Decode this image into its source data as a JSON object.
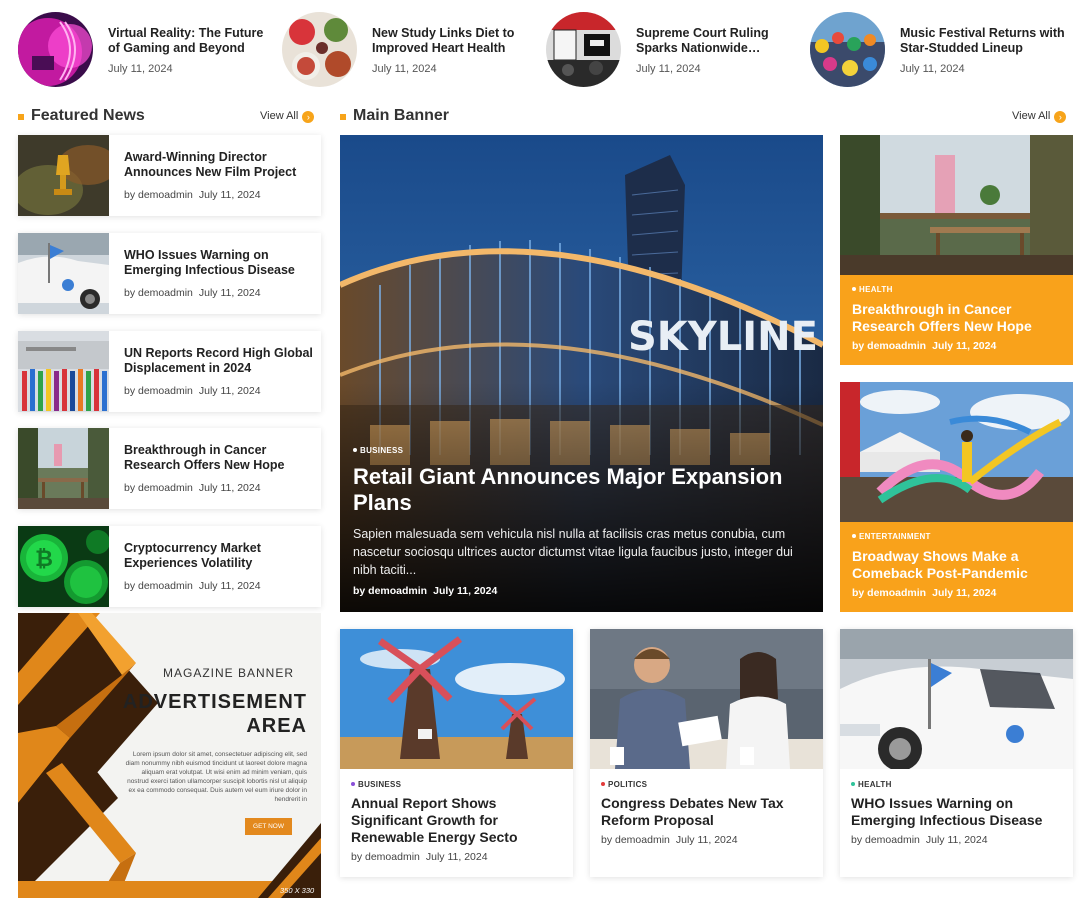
{
  "ticker": [
    {
      "title": "Virtual Reality: The Future of Gaming and Beyond",
      "date": "July 11, 2024",
      "image": "vr-headset-neon"
    },
    {
      "title": "New Study Links Diet to Improved Heart Health",
      "date": "July 11, 2024",
      "image": "healthy-food-table"
    },
    {
      "title": "Supreme Court Ruling Sparks Nationwide…",
      "date": "July 11, 2024",
      "image": "protest-signs"
    },
    {
      "title": "Music Festival Returns with Star-Studded Lineup",
      "date": "July 11, 2024",
      "image": "festival-crowd"
    }
  ],
  "featured": {
    "heading": "Featured News",
    "view_all": "View All",
    "items": [
      {
        "title": "Award-Winning Director Announces New Film Project",
        "author": "by demoadmin",
        "date": "July 11, 2024",
        "image": "golden-trophy-smoke"
      },
      {
        "title": "WHO Issues Warning on Emerging Infectious Disease",
        "author": "by demoadmin",
        "date": "July 11, 2024",
        "image": "un-vehicle-flag"
      },
      {
        "title": "UN Reports Record High Global Displacement in 2024",
        "author": "by demoadmin",
        "date": "July 11, 2024",
        "image": "un-flags-building"
      },
      {
        "title": "Breakthrough in Cancer Research Offers New Hope",
        "author": "by demoadmin",
        "date": "July 11, 2024",
        "image": "cafe-interior"
      },
      {
        "title": "Cryptocurrency Market Experiences Volatility",
        "author": "by demoadmin",
        "date": "July 11, 2024",
        "image": "green-bitcoins"
      }
    ]
  },
  "ad": {
    "small": "MAGAZINE BANNER",
    "big": "ADVERTISEMENT AREA",
    "body": "Lorem ipsum dolor sit amet, consectetuer adipiscing elit, sed diam nonummy nibh euismod tincidunt ut laoreet dolore magna aliquam erat volutpat. Ut wisi enim ad minim veniam, quis nostrud exerci tation ullamcorper suscipit lobortis nisl ut aliquip ex ea commodo consequat. Duis autem vel eum iriure dolor in hendrerit in",
    "button": "GET NOW",
    "size": "350 X 330"
  },
  "main_banner": {
    "heading": "Main Banner",
    "view_all": "View All",
    "category": "BUSINESS",
    "title": "Retail Giant Announces Major Expansion Plans",
    "excerpt": "Sapien malesuada sem vehicula nisl nulla at facilisis cras metus conubia, cum nascetur sociosqu ultrices auctor dictumst vitae ligula faucibus justo, integer dui nibh taciti...",
    "author": "by demoadmin",
    "date": "July 11, 2024",
    "sign_text": "SKYLINE PL",
    "image": "skyline-mall-night"
  },
  "side_cards": [
    {
      "category": "HEALTH",
      "title": "Breakthrough in Cancer Research Offers New Hope",
      "author": "by demoadmin",
      "date": "July 11, 2024",
      "image": "cafe-interior"
    },
    {
      "category": "ENTERTAINMENT",
      "title": "Broadway Shows Make a Comeback Post-Pandemic",
      "author": "by demoadmin",
      "date": "July 11, 2024",
      "image": "ribbon-dancer"
    }
  ],
  "bottom_cards": [
    {
      "category": "BUSINESS",
      "dot_color": "#8a4fd8",
      "title": "Annual Report Shows Significant Growth for Renewable Energy Secto",
      "author": "by demoadmin",
      "date": "July 11, 2024",
      "image": "windmills"
    },
    {
      "category": "POLITICS",
      "dot_color": "#e23b3b",
      "title": "Congress Debates New Tax Reform Proposal",
      "author": "by demoadmin",
      "date": "July 11, 2024",
      "image": "couple-paperwork"
    },
    {
      "category": "HEALTH",
      "dot_color": "#2fc39a",
      "title": "WHO Issues Warning on Emerging Infectious Disease",
      "author": "by demoadmin",
      "date": "July 11, 2024",
      "image": "un-vehicle-flag"
    }
  ],
  "colors": {
    "accent": "#f9a21b",
    "ad_orange": "#e3891e"
  }
}
